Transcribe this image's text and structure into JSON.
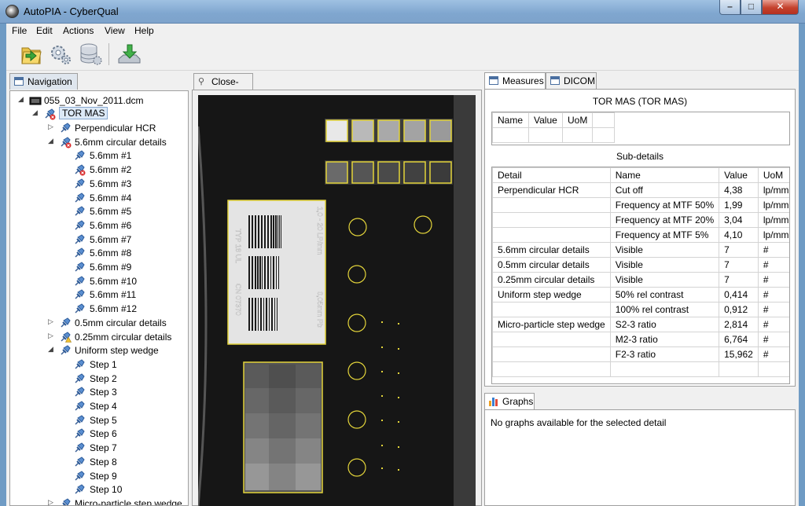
{
  "window": {
    "title": "AutoPIA - CyberQual",
    "min": "–",
    "max": "□",
    "close": "✕"
  },
  "menu": [
    "File",
    "Edit",
    "Actions",
    "View",
    "Help"
  ],
  "toolbar": {
    "icons": [
      "open-folder-icon",
      "settings-gear-icon",
      "database-settings-icon",
      "download-icon"
    ]
  },
  "navigation": {
    "tab": "Navigation",
    "file": "055_03_Nov_2011.dcm",
    "root": "TOR MAS",
    "items": [
      {
        "label": "Perpendicular HCR",
        "level": 2,
        "toggle": "▷",
        "status": "ok"
      },
      {
        "label": "5.6mm circular details",
        "level": 2,
        "toggle": "◢",
        "status": "error"
      },
      {
        "label": "5.6mm #1",
        "level": 3,
        "status": "ok"
      },
      {
        "label": "5.6mm #2",
        "level": 3,
        "status": "error"
      },
      {
        "label": "5.6mm #3",
        "level": 3,
        "status": "ok"
      },
      {
        "label": "5.6mm #4",
        "level": 3,
        "status": "ok"
      },
      {
        "label": "5.6mm #5",
        "level": 3,
        "status": "ok"
      },
      {
        "label": "5.6mm #6",
        "level": 3,
        "status": "ok"
      },
      {
        "label": "5.6mm #7",
        "level": 3,
        "status": "ok"
      },
      {
        "label": "5.6mm #8",
        "level": 3,
        "status": "ok"
      },
      {
        "label": "5.6mm #9",
        "level": 3,
        "status": "ok"
      },
      {
        "label": "5.6mm #10",
        "level": 3,
        "status": "ok"
      },
      {
        "label": "5.6mm #11",
        "level": 3,
        "status": "ok"
      },
      {
        "label": "5.6mm #12",
        "level": 3,
        "status": "ok"
      },
      {
        "label": "0.5mm circular details",
        "level": 2,
        "toggle": "▷",
        "status": "ok"
      },
      {
        "label": "0.25mm circular details",
        "level": 2,
        "toggle": "▷",
        "status": "warning"
      },
      {
        "label": "Uniform step wedge",
        "level": 2,
        "toggle": "◢",
        "status": "ok"
      },
      {
        "label": "Step 1",
        "level": 3,
        "status": "ok"
      },
      {
        "label": "Step 2",
        "level": 3,
        "status": "ok"
      },
      {
        "label": "Step 3",
        "level": 3,
        "status": "ok"
      },
      {
        "label": "Step 4",
        "level": 3,
        "status": "ok"
      },
      {
        "label": "Step 5",
        "level": 3,
        "status": "ok"
      },
      {
        "label": "Step 6",
        "level": 3,
        "status": "ok"
      },
      {
        "label": "Step 7",
        "level": 3,
        "status": "ok"
      },
      {
        "label": "Step 8",
        "level": 3,
        "status": "ok"
      },
      {
        "label": "Step 9",
        "level": 3,
        "status": "ok"
      },
      {
        "label": "Step 10",
        "level": 3,
        "status": "ok"
      },
      {
        "label": "Micro-particle step wedge",
        "level": 2,
        "toggle": "▷",
        "status": "ok"
      }
    ]
  },
  "closeup": {
    "tab": "Close-up",
    "phantom_text": [
      "1,0 - 20 LP/mm",
      "0,05mm Pb",
      "TYP 18 UL",
      "CN 07370"
    ]
  },
  "measures": {
    "tabs": [
      "Measures",
      "DICOM"
    ],
    "title": "TOR MAS (TOR MAS)",
    "columns": [
      "Name",
      "Value",
      "UoM"
    ],
    "subdetails_title": "Sub-details",
    "sub_columns": [
      "Detail",
      "Name",
      "Value",
      "UoM"
    ],
    "rows": [
      [
        "Perpendicular HCR",
        "Cut off",
        "4,38",
        "lp/mm"
      ],
      [
        "",
        "Frequency at MTF 50%",
        "1,99",
        "lp/mm"
      ],
      [
        "",
        "Frequency at MTF 20%",
        "3,04",
        "lp/mm"
      ],
      [
        "",
        "Frequency at MTF 5%",
        "4,10",
        "lp/mm"
      ],
      [
        "5.6mm circular details",
        "Visible",
        "7",
        "#"
      ],
      [
        "0.5mm circular details",
        "Visible",
        "7",
        "#"
      ],
      [
        "0.25mm circular details",
        "Visible",
        "7",
        "#"
      ],
      [
        "Uniform step wedge",
        "50% rel contrast",
        "0,414",
        "#"
      ],
      [
        "",
        "100% rel contrast",
        "0,912",
        "#"
      ],
      [
        "Micro-particle step wedge",
        "S2-3 ratio",
        "2,814",
        "#"
      ],
      [
        "",
        "M2-3 ratio",
        "6,764",
        "#"
      ],
      [
        "",
        "F2-3 ratio",
        "15,962",
        "#"
      ]
    ]
  },
  "graphs": {
    "tab": "Graphs",
    "message": "No graphs available for the selected detail"
  }
}
